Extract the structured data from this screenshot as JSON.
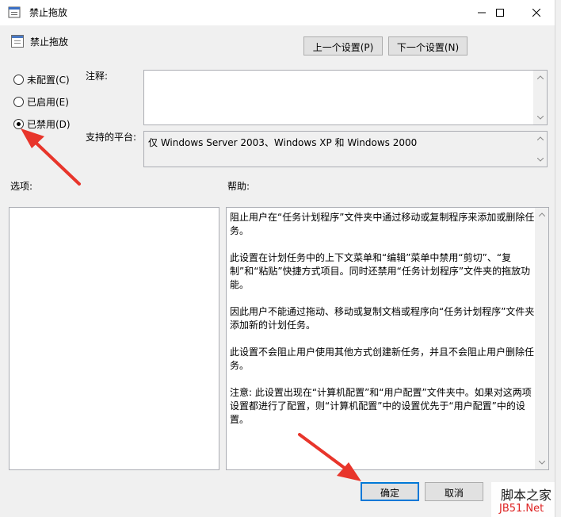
{
  "window": {
    "title": "禁止拖放"
  },
  "header": {
    "setting_name": "禁止拖放",
    "prev_button": "上一个设置(P)",
    "next_button": "下一个设置(N)"
  },
  "radio_options": [
    {
      "label": "未配置(C)",
      "checked": false
    },
    {
      "label": "已启用(E)",
      "checked": false
    },
    {
      "label": "已禁用(D)",
      "checked": true
    }
  ],
  "comment": {
    "label": "注释:",
    "value": ""
  },
  "platform": {
    "label": "支持的平台:",
    "value": "仅 Windows Server 2003、Windows XP 和 Windows 2000"
  },
  "options_label": "选项:",
  "help_label": "帮助:",
  "help_paragraphs": [
    "阻止用户在“任务计划程序”文件夹中通过移动或复制程序来添加或删除任务。",
    "此设置在计划任务中的上下文菜单和“编辑”菜单中禁用“剪切”、“复制”和“粘贴”快捷方式项目。同时还禁用“任务计划程序”文件夹的拖放功能。",
    "因此用户不能通过拖动、移动或复制文档或程序向“任务计划程序”文件夹添加新的计划任务。",
    "此设置不会阻止用户使用其他方式创建新任务，并且不会阻止用户删除任务。",
    "注意: 此设置出现在“计算机配置”和“用户配置”文件夹中。如果对这两项设置都进行了配置，则“计算机配置”中的设置优先于“用户配置”中的设置。"
  ],
  "footer": {
    "ok_button": "确定",
    "cancel_button": "取消"
  },
  "watermark": {
    "line1": "脚本之家",
    "line2": "JB51.Net"
  },
  "colors": {
    "annotation_arrow": "#e8352b",
    "focus_border": "#0078d7"
  }
}
